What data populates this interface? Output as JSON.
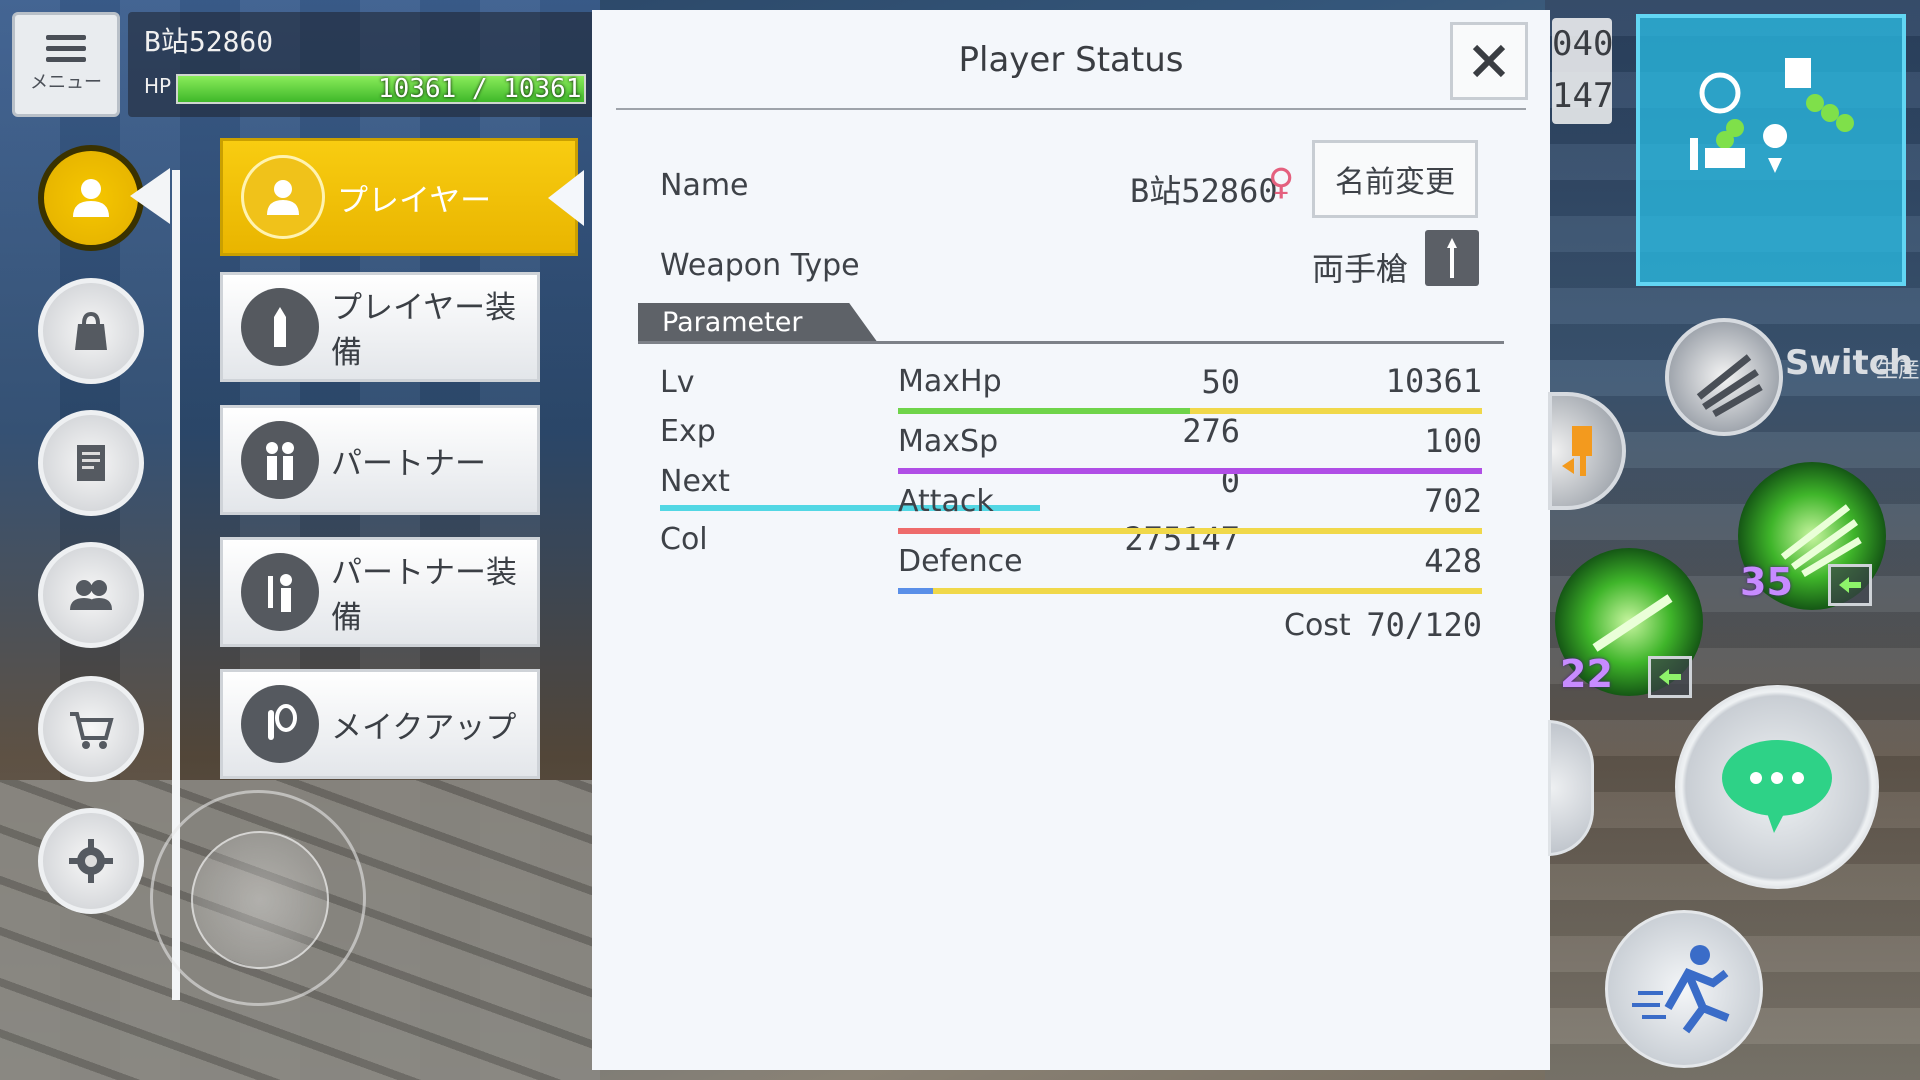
{
  "hud": {
    "menu_label": "メニュー",
    "player_name": "B站52860",
    "hp_label": "HP",
    "hp_current": 10361,
    "hp_max": 10361,
    "hp_text": "10361 / 10361",
    "hp_fill_fraction": 1.0
  },
  "clock": {
    "line1": "040",
    "line2": "147"
  },
  "submenu": [
    {
      "label": "プレイヤー",
      "icon": "player-icon",
      "active": true
    },
    {
      "label": "プレイヤー装備",
      "icon": "equipment-icon",
      "active": false
    },
    {
      "label": "パートナー",
      "icon": "partner-icon",
      "active": false
    },
    {
      "label": "パートナー装備",
      "icon": "partner-equipment-icon",
      "active": false
    },
    {
      "label": "メイクアップ",
      "icon": "makeup-icon",
      "active": false
    }
  ],
  "sidebar_icons": [
    "player-icon",
    "bag-icon",
    "quest-icon",
    "party-icon",
    "shop-icon",
    "settings-icon"
  ],
  "panel": {
    "title": "Player Status",
    "name_label": "Name",
    "name_value": "B站52860",
    "gender_symbol": "♀",
    "rename_button": "名前変更",
    "weapon_label": "Weapon Type",
    "weapon_value": "両手槍",
    "parameter_tab": "Parameter",
    "left_params": [
      {
        "label": "Lv",
        "value": "50"
      },
      {
        "label": "Exp",
        "value": "276"
      },
      {
        "label": "Next",
        "value": "0"
      },
      {
        "label": "Col",
        "value": "275147"
      }
    ],
    "next_bar_fraction": 1.0,
    "right_params": [
      {
        "label": "MaxHp",
        "value": "10361",
        "fill_fraction": 0.5,
        "color": "#6fd44a"
      },
      {
        "label": "MaxSp",
        "value": "100",
        "fill_fraction": 1.0,
        "color": "#b04ee6"
      },
      {
        "label": "Attack",
        "value": "702",
        "fill_fraction": 0.14,
        "color": "#ee6b6b"
      },
      {
        "label": "Defence",
        "value": "428",
        "fill_fraction": 0.06,
        "color": "#5a8fe8"
      }
    ],
    "bar_track_color": "#f0d84a",
    "cost_label": "Cost",
    "cost_value": "70/120"
  },
  "skills": {
    "switch_label": "Switch",
    "production_label": "生産",
    "skill1_count": "35",
    "skill2_count": "22"
  },
  "colors": {
    "accent_yellow": "#f2c40a",
    "next_bar": "#52d7e4",
    "gender_pink": "#e4607e",
    "minimap": "#33c4ea"
  }
}
